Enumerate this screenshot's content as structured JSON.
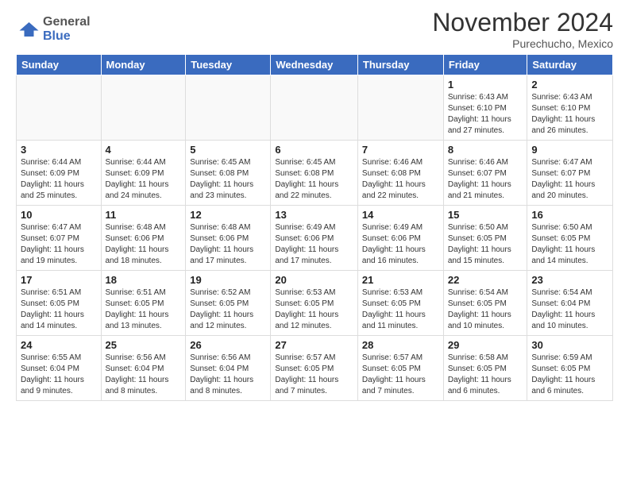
{
  "logo": {
    "line1": "General",
    "line2": "Blue"
  },
  "title": "November 2024",
  "location": "Purechucho, Mexico",
  "headers": [
    "Sunday",
    "Monday",
    "Tuesday",
    "Wednesday",
    "Thursday",
    "Friday",
    "Saturday"
  ],
  "weeks": [
    [
      {
        "day": "",
        "info": "",
        "empty": true
      },
      {
        "day": "",
        "info": "",
        "empty": true
      },
      {
        "day": "",
        "info": "",
        "empty": true
      },
      {
        "day": "",
        "info": "",
        "empty": true
      },
      {
        "day": "",
        "info": "",
        "empty": true
      },
      {
        "day": "1",
        "info": "Sunrise: 6:43 AM\nSunset: 6:10 PM\nDaylight: 11 hours\nand 27 minutes."
      },
      {
        "day": "2",
        "info": "Sunrise: 6:43 AM\nSunset: 6:10 PM\nDaylight: 11 hours\nand 26 minutes."
      }
    ],
    [
      {
        "day": "3",
        "info": "Sunrise: 6:44 AM\nSunset: 6:09 PM\nDaylight: 11 hours\nand 25 minutes."
      },
      {
        "day": "4",
        "info": "Sunrise: 6:44 AM\nSunset: 6:09 PM\nDaylight: 11 hours\nand 24 minutes."
      },
      {
        "day": "5",
        "info": "Sunrise: 6:45 AM\nSunset: 6:08 PM\nDaylight: 11 hours\nand 23 minutes."
      },
      {
        "day": "6",
        "info": "Sunrise: 6:45 AM\nSunset: 6:08 PM\nDaylight: 11 hours\nand 22 minutes."
      },
      {
        "day": "7",
        "info": "Sunrise: 6:46 AM\nSunset: 6:08 PM\nDaylight: 11 hours\nand 22 minutes."
      },
      {
        "day": "8",
        "info": "Sunrise: 6:46 AM\nSunset: 6:07 PM\nDaylight: 11 hours\nand 21 minutes."
      },
      {
        "day": "9",
        "info": "Sunrise: 6:47 AM\nSunset: 6:07 PM\nDaylight: 11 hours\nand 20 minutes."
      }
    ],
    [
      {
        "day": "10",
        "info": "Sunrise: 6:47 AM\nSunset: 6:07 PM\nDaylight: 11 hours\nand 19 minutes."
      },
      {
        "day": "11",
        "info": "Sunrise: 6:48 AM\nSunset: 6:06 PM\nDaylight: 11 hours\nand 18 minutes."
      },
      {
        "day": "12",
        "info": "Sunrise: 6:48 AM\nSunset: 6:06 PM\nDaylight: 11 hours\nand 17 minutes."
      },
      {
        "day": "13",
        "info": "Sunrise: 6:49 AM\nSunset: 6:06 PM\nDaylight: 11 hours\nand 17 minutes."
      },
      {
        "day": "14",
        "info": "Sunrise: 6:49 AM\nSunset: 6:06 PM\nDaylight: 11 hours\nand 16 minutes."
      },
      {
        "day": "15",
        "info": "Sunrise: 6:50 AM\nSunset: 6:05 PM\nDaylight: 11 hours\nand 15 minutes."
      },
      {
        "day": "16",
        "info": "Sunrise: 6:50 AM\nSunset: 6:05 PM\nDaylight: 11 hours\nand 14 minutes."
      }
    ],
    [
      {
        "day": "17",
        "info": "Sunrise: 6:51 AM\nSunset: 6:05 PM\nDaylight: 11 hours\nand 14 minutes."
      },
      {
        "day": "18",
        "info": "Sunrise: 6:51 AM\nSunset: 6:05 PM\nDaylight: 11 hours\nand 13 minutes."
      },
      {
        "day": "19",
        "info": "Sunrise: 6:52 AM\nSunset: 6:05 PM\nDaylight: 11 hours\nand 12 minutes."
      },
      {
        "day": "20",
        "info": "Sunrise: 6:53 AM\nSunset: 6:05 PM\nDaylight: 11 hours\nand 12 minutes."
      },
      {
        "day": "21",
        "info": "Sunrise: 6:53 AM\nSunset: 6:05 PM\nDaylight: 11 hours\nand 11 minutes."
      },
      {
        "day": "22",
        "info": "Sunrise: 6:54 AM\nSunset: 6:05 PM\nDaylight: 11 hours\nand 10 minutes."
      },
      {
        "day": "23",
        "info": "Sunrise: 6:54 AM\nSunset: 6:04 PM\nDaylight: 11 hours\nand 10 minutes."
      }
    ],
    [
      {
        "day": "24",
        "info": "Sunrise: 6:55 AM\nSunset: 6:04 PM\nDaylight: 11 hours\nand 9 minutes."
      },
      {
        "day": "25",
        "info": "Sunrise: 6:56 AM\nSunset: 6:04 PM\nDaylight: 11 hours\nand 8 minutes."
      },
      {
        "day": "26",
        "info": "Sunrise: 6:56 AM\nSunset: 6:04 PM\nDaylight: 11 hours\nand 8 minutes."
      },
      {
        "day": "27",
        "info": "Sunrise: 6:57 AM\nSunset: 6:05 PM\nDaylight: 11 hours\nand 7 minutes."
      },
      {
        "day": "28",
        "info": "Sunrise: 6:57 AM\nSunset: 6:05 PM\nDaylight: 11 hours\nand 7 minutes."
      },
      {
        "day": "29",
        "info": "Sunrise: 6:58 AM\nSunset: 6:05 PM\nDaylight: 11 hours\nand 6 minutes."
      },
      {
        "day": "30",
        "info": "Sunrise: 6:59 AM\nSunset: 6:05 PM\nDaylight: 11 hours\nand 6 minutes."
      }
    ]
  ]
}
